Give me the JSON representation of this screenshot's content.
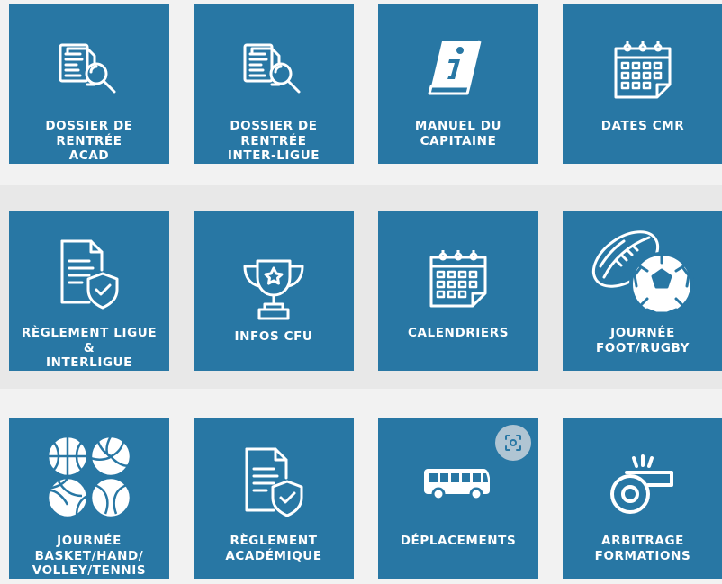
{
  "theme": {
    "tile_color": "#2877a4",
    "text_color": "#ffffff",
    "background": "#f1f1f1"
  },
  "tiles": [
    {
      "icon": "document-search-icon",
      "lines": [
        "DOSSIER DE",
        "RENTRÉE",
        "ACAD"
      ]
    },
    {
      "icon": "document-search-icon",
      "lines": [
        "DOSSIER DE",
        "RENTRÉE",
        "INTER-LIGUE"
      ]
    },
    {
      "icon": "info-book-icon",
      "lines": [
        "MANUEL DU",
        "CAPITAINE"
      ]
    },
    {
      "icon": "calendar-icon",
      "lines": [
        "DATES CMR"
      ]
    },
    {
      "icon": "document-shield-icon",
      "lines": [
        "RÈGLEMENT LIGUE",
        "&",
        "INTERLIGUE"
      ]
    },
    {
      "icon": "trophy-icon",
      "lines": [
        "INFOS CFU"
      ]
    },
    {
      "icon": "calendar-icon",
      "lines": [
        "CALENDRIERS"
      ]
    },
    {
      "icon": "football-rugby-icon",
      "lines": [
        "JOURNÉE",
        "FOOT/RUGBY"
      ]
    },
    {
      "icon": "sports-balls-icon",
      "lines": [
        "JOURNÉE",
        "BASKET/HAND/",
        "VOLLEY/TENNIS"
      ]
    },
    {
      "icon": "document-shield-icon",
      "lines": [
        "RÈGLEMENT",
        "ACADÉMIQUE"
      ]
    },
    {
      "icon": "bus-icon",
      "lines": [
        "DÉPLACEMENTS"
      ]
    },
    {
      "icon": "whistle-icon",
      "lines": [
        "ARBITRAGE",
        "FORMATIONS"
      ]
    }
  ],
  "overlay": {
    "icon": "visual-search-icon"
  }
}
